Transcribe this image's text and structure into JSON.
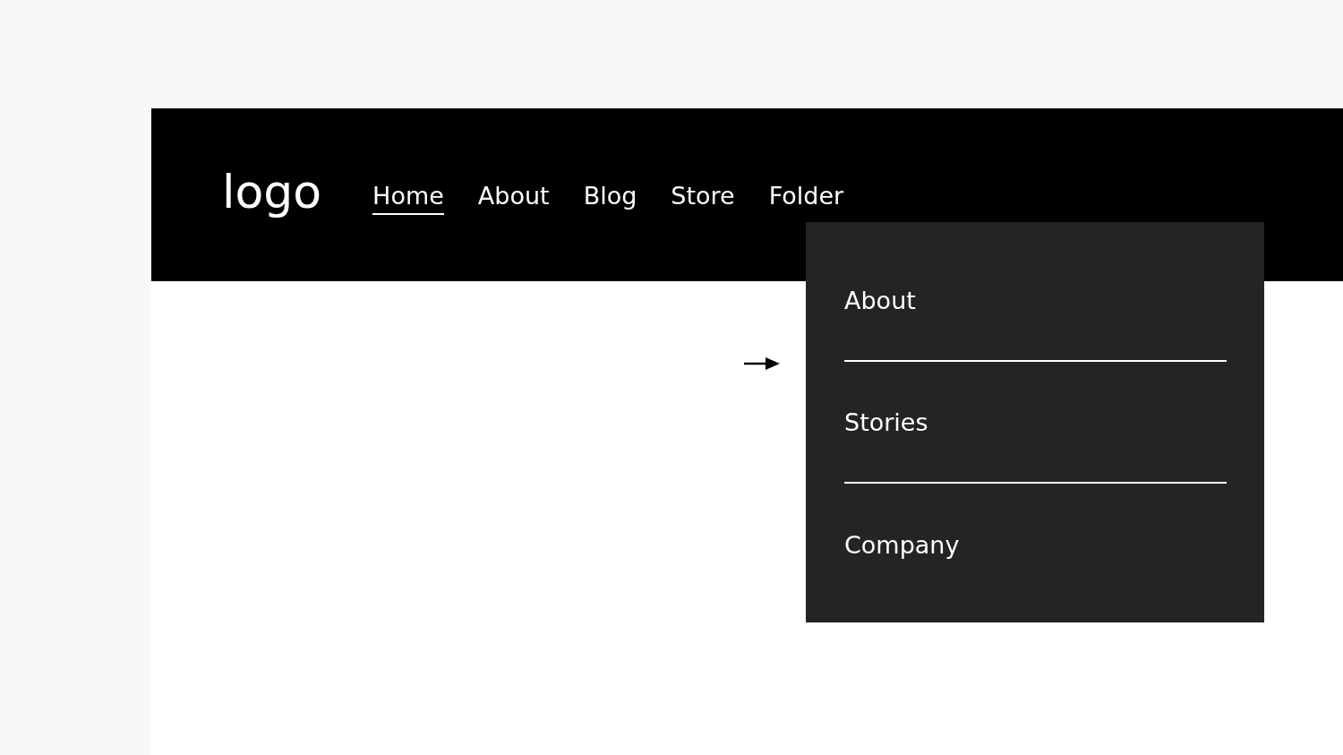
{
  "logo": "logo",
  "nav": [
    {
      "label": "Home",
      "selected": true
    },
    {
      "label": "About",
      "selected": false
    },
    {
      "label": "Blog",
      "selected": false
    },
    {
      "label": "Store",
      "selected": false
    },
    {
      "label": "Folder",
      "selected": false
    }
  ],
  "folder_menu": {
    "open": true,
    "items": [
      {
        "label": "About"
      },
      {
        "label": "Stories"
      },
      {
        "label": "Company"
      }
    ]
  }
}
